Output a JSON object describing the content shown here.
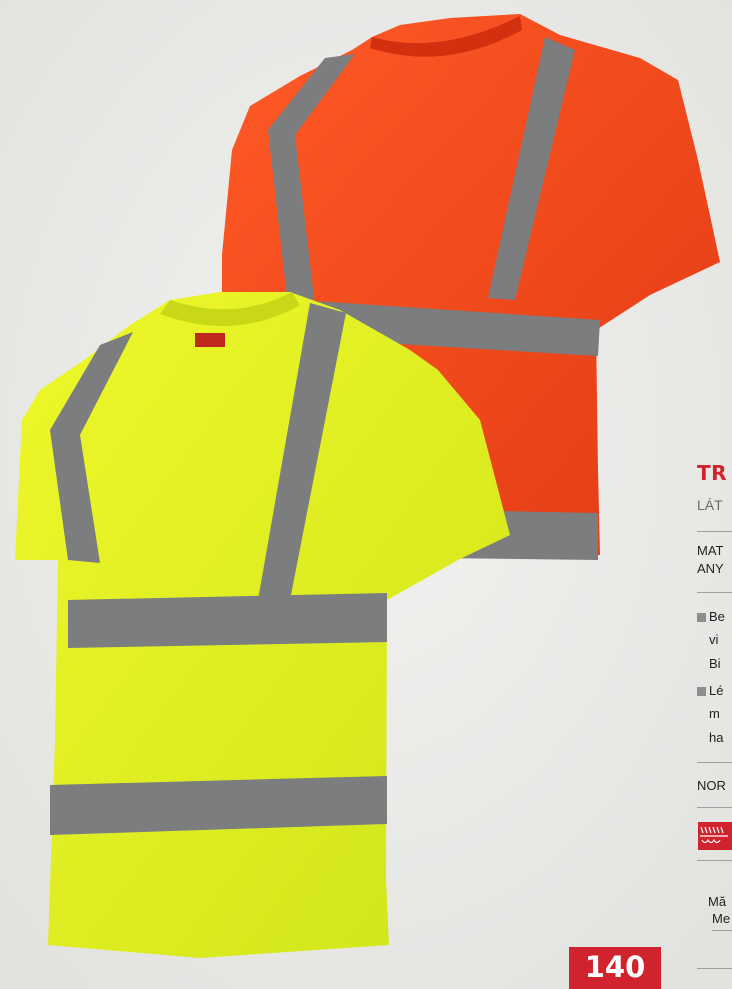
{
  "product": {
    "title": "TR",
    "subtitle": "LÁT",
    "material_lines": [
      "MAT",
      "ANY"
    ],
    "bullets": [
      [
        "Be",
        "vi",
        "Bi"
      ],
      [
        "Lé",
        "m",
        "ha"
      ]
    ],
    "norm_label": "NOR",
    "size_lines": [
      "Mă",
      "Me"
    ]
  },
  "page_number": "140",
  "colors": {
    "accent_red": "#d0232d",
    "shirt_orange": "#fb4a1c",
    "shirt_yellow": "#e4f522",
    "reflective_stripe": "#7b7d7e"
  },
  "images": {
    "orange_shirt": "orange-hi-vis-tshirt",
    "yellow_shirt": "yellow-hi-vis-tshirt",
    "norm_pictogram": "red-norm-pictogram"
  }
}
